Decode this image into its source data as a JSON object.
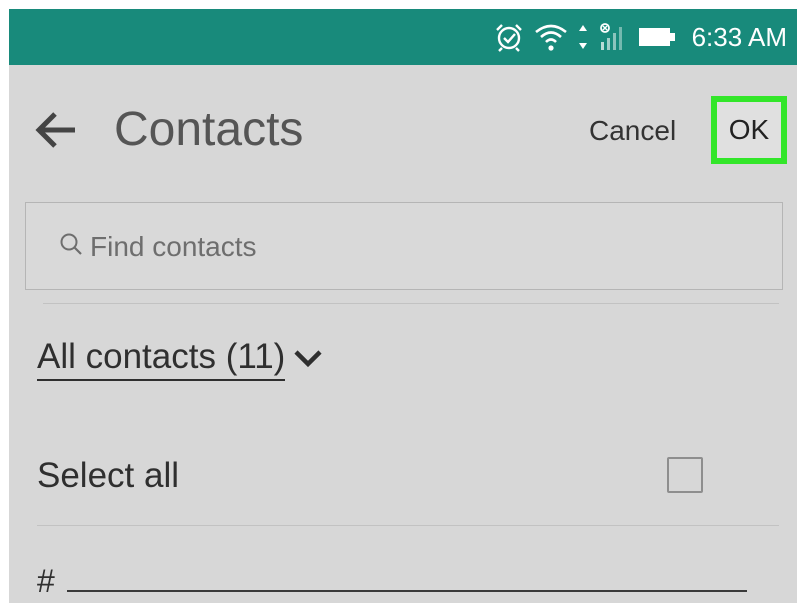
{
  "status_bar": {
    "time": "6:33 AM",
    "icons": [
      "alarm-icon",
      "wifi-icon",
      "data-transfer-icon",
      "cell-signal-icon",
      "battery-icon"
    ],
    "background_color": "#188a7b"
  },
  "header": {
    "title": "Contacts",
    "cancel_label": "Cancel",
    "ok_label": "OK",
    "ok_highlight_color": "#33e62a"
  },
  "search": {
    "placeholder": "Find contacts"
  },
  "filter": {
    "label": "All contacts (11)"
  },
  "select_all": {
    "label": "Select all",
    "checked": false
  },
  "list": {
    "section_header": "#"
  }
}
